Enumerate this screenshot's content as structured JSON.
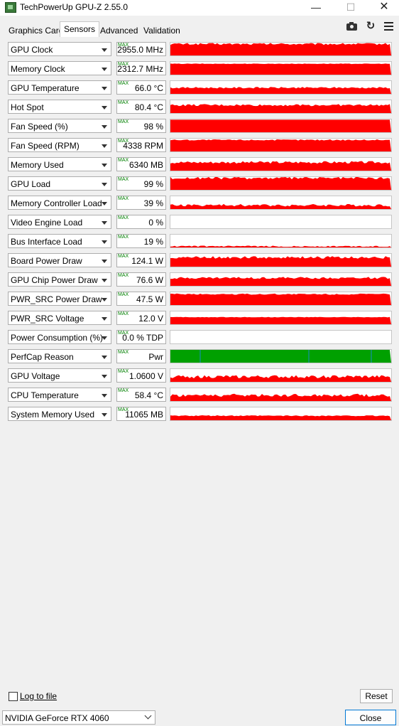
{
  "window": {
    "title": "TechPowerUp GPU-Z 2.55.0",
    "minimize_glyph": "—",
    "maximize_glyph": "☐",
    "close_glyph": "✕"
  },
  "tabs": [
    {
      "label": "Graphics Card",
      "active": false
    },
    {
      "label": "Sensors",
      "active": true
    },
    {
      "label": "Advanced",
      "active": false
    },
    {
      "label": "Validation",
      "active": false
    }
  ],
  "toolbar_icons": [
    "camera-icon",
    "refresh-icon",
    "hamburger-menu-icon"
  ],
  "refresh_glyph": "↻",
  "max_tag": "MAX",
  "graph_colors": {
    "red": "#ff0000",
    "green": "#00a000",
    "blue_marker": "#1a8cc8"
  },
  "sensors": [
    {
      "label": "GPU Clock",
      "value": "2955.0 MHz",
      "level": 0.9,
      "variation": 0.08,
      "color": "red"
    },
    {
      "label": "Memory Clock",
      "value": "2312.7 MHz",
      "level": 0.85,
      "variation": 0.02,
      "color": "red"
    },
    {
      "label": "GPU Temperature",
      "value": "66.0 °C",
      "level": 0.48,
      "variation": 0.06,
      "color": "red"
    },
    {
      "label": "Hot Spot",
      "value": "80.4 °C",
      "level": 0.62,
      "variation": 0.08,
      "color": "red"
    },
    {
      "label": "Fan Speed (%)",
      "value": "98 %",
      "level": 0.98,
      "variation": 0.0,
      "color": "red"
    },
    {
      "label": "Fan Speed (RPM)",
      "value": "4338 RPM",
      "level": 0.9,
      "variation": 0.05,
      "color": "red"
    },
    {
      "label": "Memory Used",
      "value": "6340 MB",
      "level": 0.65,
      "variation": 0.1,
      "color": "red"
    },
    {
      "label": "GPU Load",
      "value": "99 %",
      "level": 0.92,
      "variation": 0.1,
      "color": "red"
    },
    {
      "label": "Memory Controller Load",
      "value": "39 %",
      "level": 0.3,
      "variation": 0.1,
      "color": "red"
    },
    {
      "label": "Video Engine Load",
      "value": "0 %",
      "level": 0.0,
      "variation": 0.0,
      "color": "red"
    },
    {
      "label": "Bus Interface Load",
      "value": "19 %",
      "level": 0.08,
      "variation": 0.06,
      "color": "red"
    },
    {
      "label": "Board Power Draw",
      "value": "124.1 W",
      "level": 0.72,
      "variation": 0.1,
      "color": "red"
    },
    {
      "label": "GPU Chip Power Draw",
      "value": "76.6 W",
      "level": 0.62,
      "variation": 0.08,
      "color": "red"
    },
    {
      "label": "PWR_SRC Power Draw",
      "value": "47.5 W",
      "level": 0.85,
      "variation": 0.05,
      "color": "red"
    },
    {
      "label": "PWR_SRC Voltage",
      "value": "12.0 V",
      "level": 0.55,
      "variation": 0.02,
      "color": "red"
    },
    {
      "label": "Power Consumption (%)",
      "value": "0.0 % TDP",
      "level": 0.0,
      "variation": 0.0,
      "color": "red"
    },
    {
      "label": "PerfCap Reason",
      "value": "Pwr",
      "level": 1.0,
      "variation": 0.0,
      "color": "green"
    },
    {
      "label": "GPU Voltage",
      "value": "1.0600 V",
      "level": 0.4,
      "variation": 0.12,
      "color": "red"
    },
    {
      "label": "CPU Temperature",
      "value": "58.4 °C",
      "level": 0.45,
      "variation": 0.12,
      "color": "red"
    },
    {
      "label": "System Memory Used",
      "value": "11065 MB",
      "level": 0.35,
      "variation": 0.04,
      "color": "red"
    }
  ],
  "footer": {
    "log_to_file_label": "Log to file",
    "log_to_file_checked": false,
    "reset_label": "Reset",
    "gpu_name": "NVIDIA GeForce RTX 4060",
    "close_label": "Close"
  }
}
